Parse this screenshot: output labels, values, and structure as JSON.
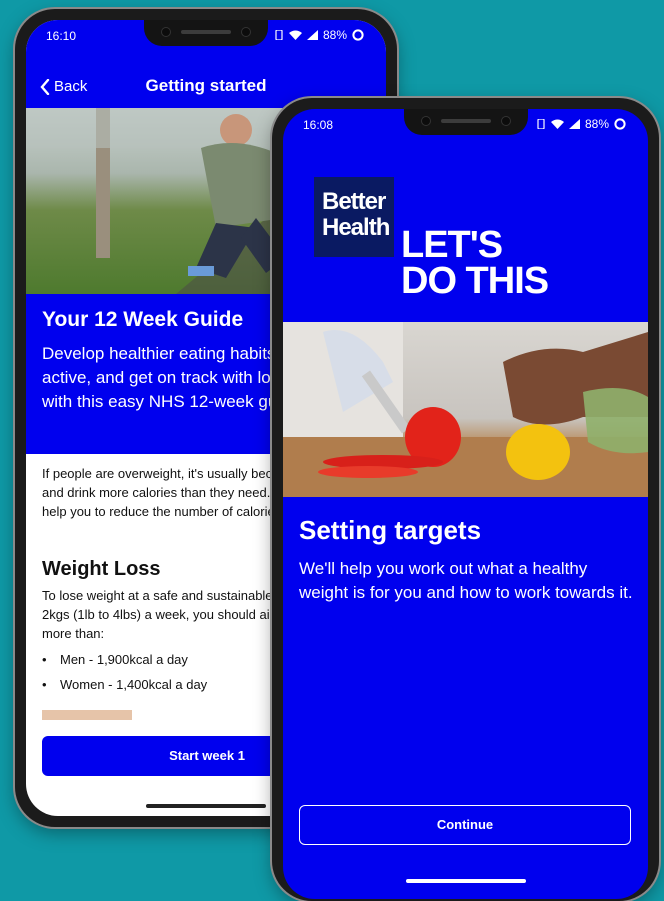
{
  "back_screen": {
    "status": {
      "time": "16:10",
      "battery": "88%"
    },
    "nav": {
      "back_label": "Back",
      "title": "Getting started"
    },
    "guide": {
      "title": "Your 12 Week Guide",
      "text": "Develop healthier eating habits, be more active, and get on track with losing weight with this easy NHS 12-week guide."
    },
    "intro": "If people are overweight, it's usually because they eat and drink more calories than they need. This app will help you to reduce the number of calories you consume.",
    "weight_loss": {
      "title": "Weight Loss",
      "text": "To lose weight at a safe and sustainable rate of 0.5kg to 2kgs (1lb to 4lbs) a week, you should aim to consume no more than:",
      "bullets": [
        "Men - 1,900kcal a day",
        "Women - 1,400kcal a day"
      ]
    },
    "start_button": "Start week 1"
  },
  "front_screen": {
    "status": {
      "time": "16:08",
      "battery": "88%"
    },
    "logo_line1": "Better",
    "logo_line2": "Health",
    "slogan_line1": "LET'S",
    "slogan_line2": "DO THIS",
    "title": "Setting targets",
    "text": "We'll help you work out what a healthy weight is for you and how to work towards it.",
    "continue_button": "Continue"
  },
  "colors": {
    "background": "#0f99a6",
    "brand_blue": "#0000ee",
    "logo_navy": "#0a1a62"
  }
}
